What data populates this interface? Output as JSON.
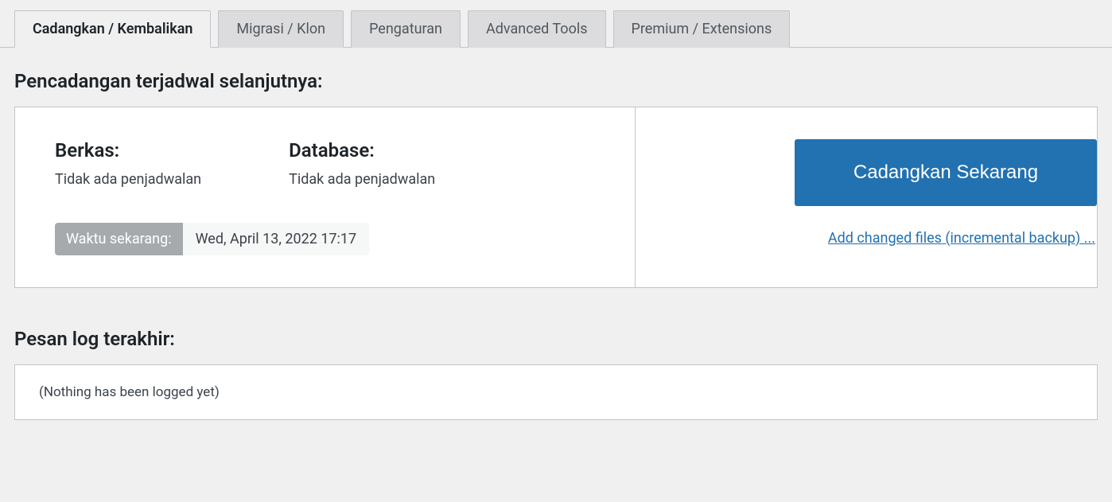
{
  "tabs": [
    {
      "label": "Cadangkan / Kembalikan",
      "active": true
    },
    {
      "label": "Migrasi / Klon",
      "active": false
    },
    {
      "label": "Pengaturan",
      "active": false
    },
    {
      "label": "Advanced Tools",
      "active": false
    },
    {
      "label": "Premium / Extensions",
      "active": false
    }
  ],
  "schedule": {
    "heading": "Pencadangan terjadwal selanjutnya:",
    "files_label": "Berkas:",
    "files_value": "Tidak ada penjadwalan",
    "database_label": "Database:",
    "database_value": "Tidak ada penjadwalan",
    "time_label": "Waktu sekarang:",
    "time_value": "Wed, April 13, 2022 17:17",
    "backup_now_label": "Cadangkan Sekarang",
    "incremental_link": "Add changed files (incremental backup) ..."
  },
  "log": {
    "heading": "Pesan log terakhir:",
    "empty_message": "(Nothing has been logged yet)"
  }
}
